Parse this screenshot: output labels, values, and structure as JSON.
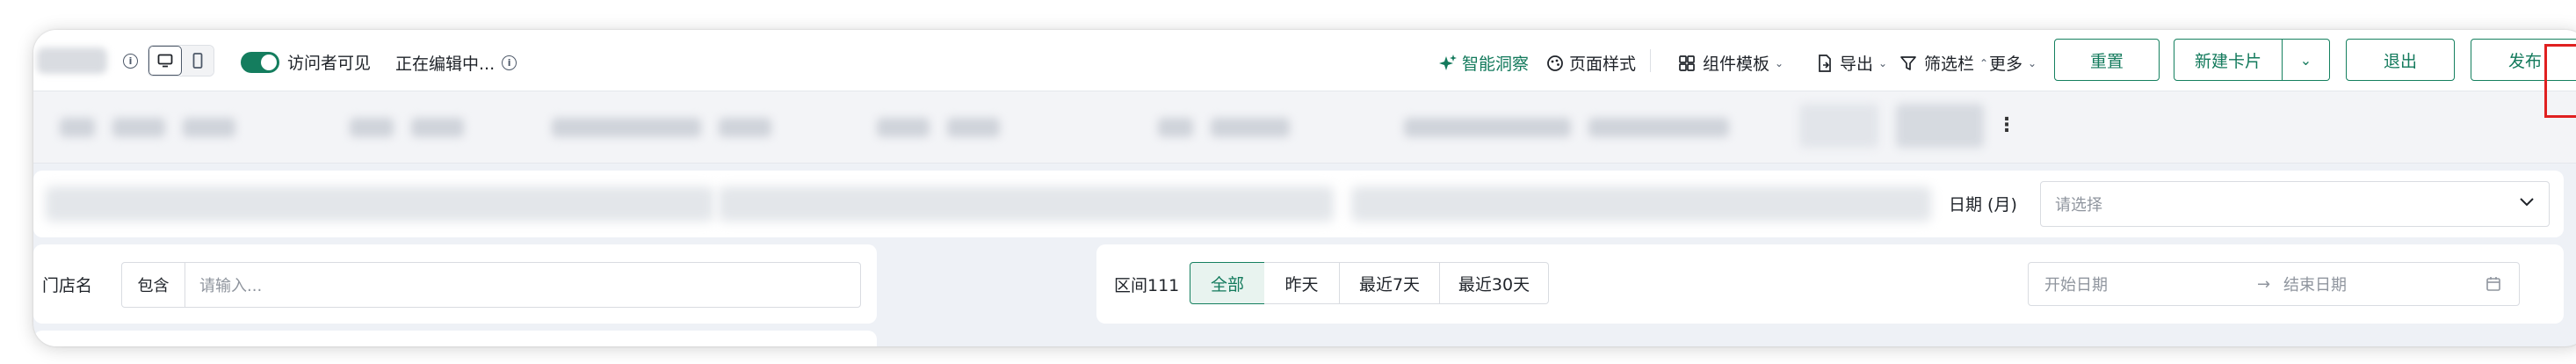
{
  "toolbar": {
    "visible_to_visitors": "访问者可见",
    "editing_status": "正在编辑中...",
    "smart_insight": "智能洞察",
    "page_style": "页面样式",
    "component_template": "组件模板",
    "export": "导出",
    "filter_bar": "筛选栏",
    "more": "更多",
    "reset": "重置",
    "new_card": "新建卡片",
    "exit": "退出",
    "publish": "发布"
  },
  "filters": {
    "date_month_label": "日期 (月)",
    "date_month_placeholder": "请选择",
    "store_label": "门店名",
    "store_operator": "包含",
    "store_placeholder": "请输入...",
    "range_label": "区间111",
    "range_options": [
      "全部",
      "昨天",
      "最近7天",
      "最近30天"
    ],
    "range_selected": "全部",
    "start_date_placeholder": "开始日期",
    "end_date_placeholder": "结束日期",
    "range_arrow": "→"
  },
  "colors": {
    "accent": "#137a5c",
    "highlight": "#e02020"
  }
}
